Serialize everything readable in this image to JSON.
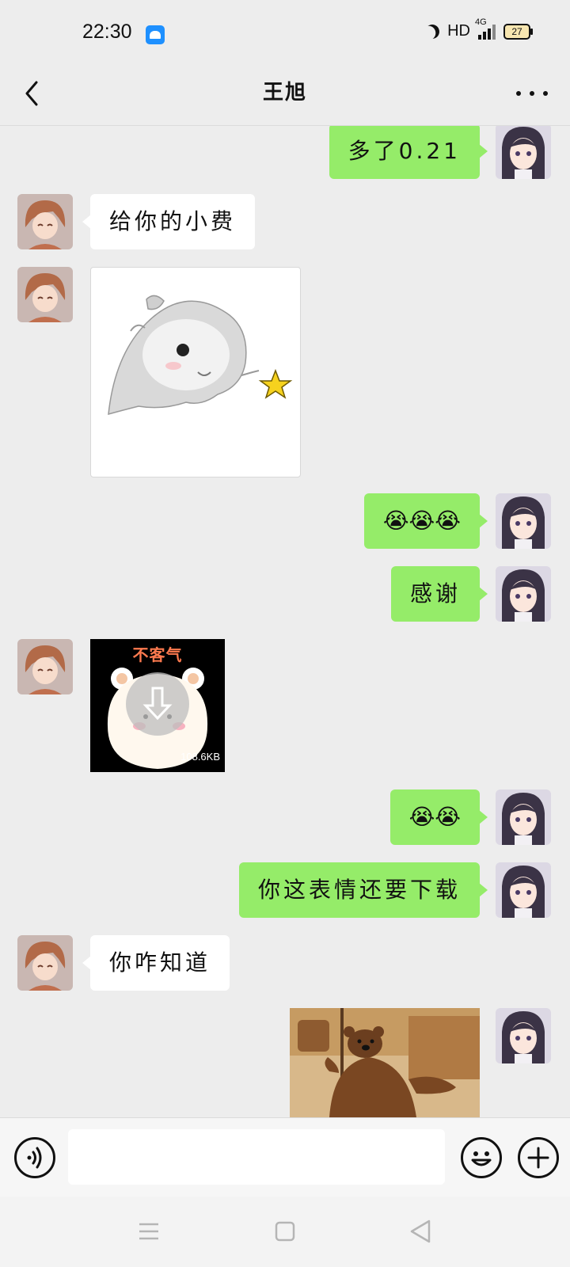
{
  "status_bar": {
    "time": "22:30",
    "hd_label": "HD",
    "network_label": "4G",
    "battery_level": "27"
  },
  "header": {
    "title": "王旭"
  },
  "messages": [
    {
      "side": "me",
      "type": "text",
      "text": "多了0.21"
    },
    {
      "side": "other",
      "type": "text",
      "text": "给你的小费"
    },
    {
      "side": "other",
      "type": "sticker",
      "sticker_name": "hamster-sticker"
    },
    {
      "side": "me",
      "type": "text",
      "text": "😭😭😭"
    },
    {
      "side": "me",
      "type": "text",
      "text": "感谢"
    },
    {
      "side": "other",
      "type": "sticker",
      "sticker_name": "bear-sticker-not-downloaded",
      "sticker_text": "不客气",
      "size_label": "108.6KB"
    },
    {
      "side": "me",
      "type": "text",
      "text": "😭😭"
    },
    {
      "side": "me",
      "type": "text",
      "text": "你这表情还要下载"
    },
    {
      "side": "other",
      "type": "text",
      "text": "你咋知道"
    },
    {
      "side": "me",
      "type": "sticker",
      "sticker_name": "brown-bear-sticker"
    }
  ],
  "input_bar": {
    "placeholder": "",
    "voice_icon": "voice-icon",
    "emoji_icon": "emoji-icon",
    "add_icon": "plus-icon"
  },
  "colors": {
    "background": "#ededed",
    "my_bubble": "#95ec69",
    "other_bubble": "#ffffff"
  }
}
